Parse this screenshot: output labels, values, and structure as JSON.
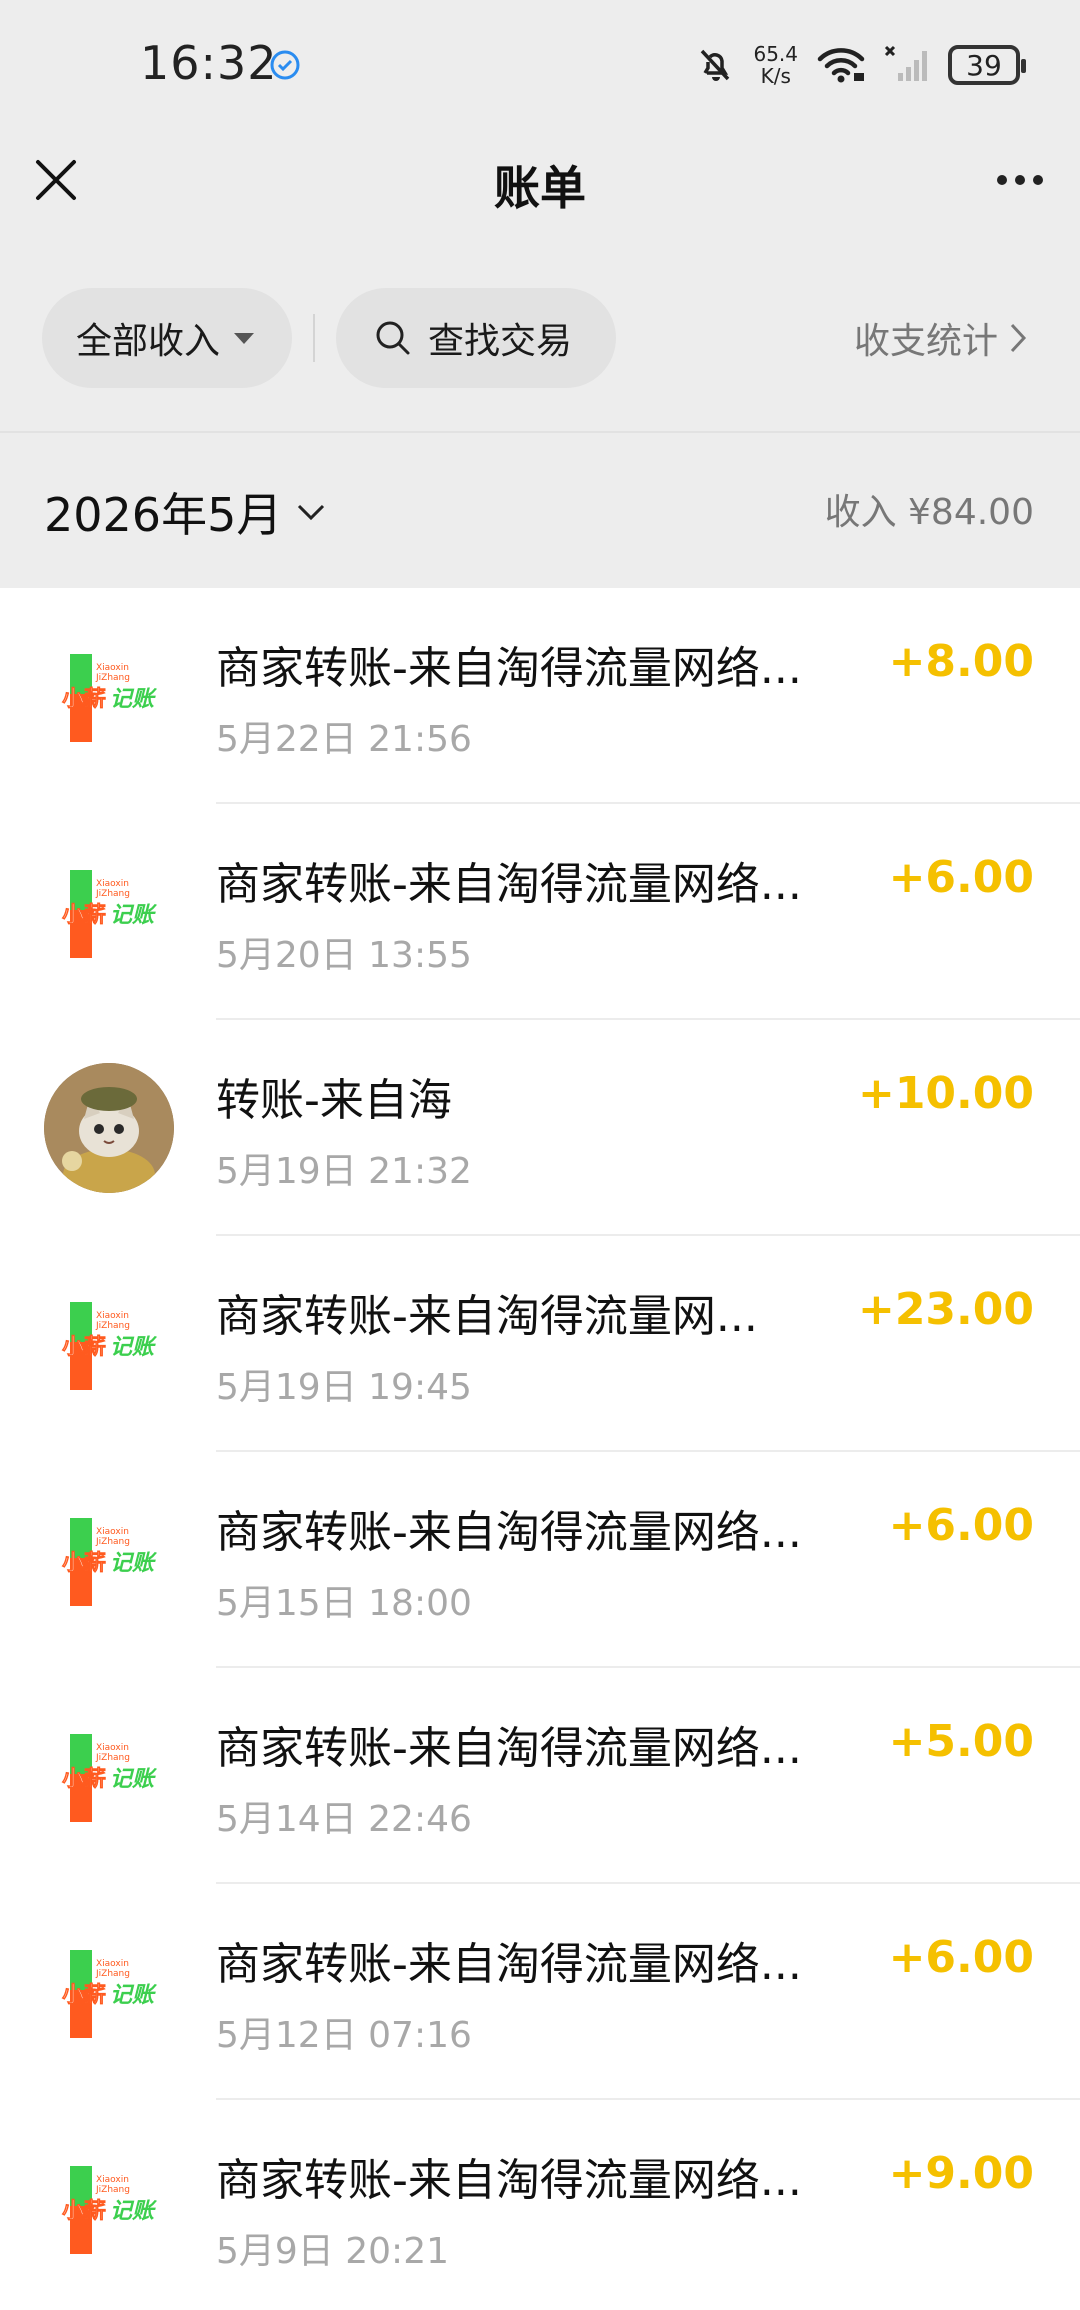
{
  "status_bar": {
    "time": "16:32",
    "net_speed_value": "65.4",
    "net_speed_unit": "K/s",
    "battery": "39",
    "icons": [
      "verified-icon",
      "mute-bell-icon",
      "wifi-icon",
      "no-signal-icon",
      "battery-icon"
    ]
  },
  "nav": {
    "title": "账单",
    "close_icon": "close-icon",
    "more_icon": "more-icon"
  },
  "filters": {
    "income_filter": "全部收入",
    "search": "查找交易",
    "stats": "收支统计"
  },
  "month": {
    "label": "2026年5月",
    "summary": "收入 ¥84.00"
  },
  "transactions": [
    {
      "title": "商家转账-来自淘得流量网络...",
      "time": "5月22日 21:56",
      "amount": "+8.00",
      "avatar": "merchant-logo"
    },
    {
      "title": "商家转账-来自淘得流量网络...",
      "time": "5月20日 13:55",
      "amount": "+6.00",
      "avatar": "merchant-logo"
    },
    {
      "title": "转账-来自海",
      "time": "5月19日 21:32",
      "amount": "+10.00",
      "avatar": "cat-avatar"
    },
    {
      "title": "商家转账-来自淘得流量网...",
      "time": "5月19日 19:45",
      "amount": "+23.00",
      "avatar": "merchant-logo"
    },
    {
      "title": "商家转账-来自淘得流量网络...",
      "time": "5月15日 18:00",
      "amount": "+6.00",
      "avatar": "merchant-logo"
    },
    {
      "title": "商家转账-来自淘得流量网络...",
      "time": "5月14日 22:46",
      "amount": "+5.00",
      "avatar": "merchant-logo"
    },
    {
      "title": "商家转账-来自淘得流量网络...",
      "time": "5月12日 07:16",
      "amount": "+6.00",
      "avatar": "merchant-logo"
    },
    {
      "title": "商家转账-来自淘得流量网络...",
      "time": "5月9日 20:21",
      "amount": "+9.00",
      "avatar": "merchant-logo"
    }
  ],
  "merchant_logo": {
    "small_text_1": "Xiaoxin",
    "small_text_2": "JiZhang",
    "text_left": "小薪",
    "text_right": "记账"
  },
  "colors": {
    "amount": "#f5c000",
    "logo_green": "#3ccf4e",
    "logo_orange": "#ff5a1f",
    "header_bg": "#ededed"
  }
}
